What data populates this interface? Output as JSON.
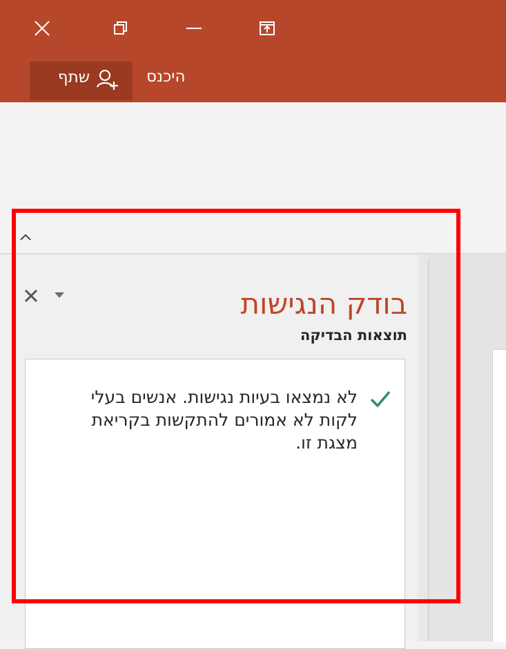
{
  "titlebar": {
    "color": "#b7472a",
    "controls": [
      {
        "name": "close",
        "icon": "close-icon"
      },
      {
        "name": "restore",
        "icon": "restore-icon"
      },
      {
        "name": "minimize",
        "icon": "minimize-icon"
      },
      {
        "name": "ribbon-display-options",
        "icon": "ribbon-display-icon"
      }
    ],
    "share_label": "שתף",
    "signin_label": "היכנס"
  },
  "pane": {
    "title": "בודק הנגישות",
    "subtitle": "תוצאות הבדיקה",
    "result_text": "לא נמצאו בעיות נגישות. אנשים בעלי לקות לא אמורים להתקשות בקריאת מצגת זו.",
    "result_icon": "checkmark-icon",
    "title_color": "#c0462a",
    "check_color": "#2e8b6a"
  },
  "highlight_color": "#ff0000"
}
